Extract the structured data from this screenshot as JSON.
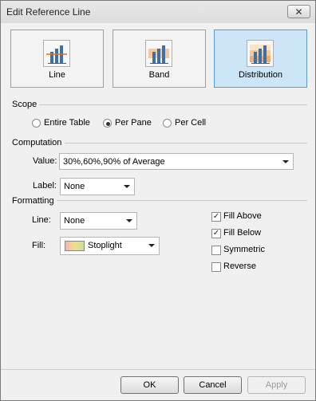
{
  "window": {
    "title": "Edit Reference Line",
    "close_glyph": "✕"
  },
  "type_buttons": [
    {
      "label": "Line",
      "icon": "reference-line-icon",
      "selected": false
    },
    {
      "label": "Band",
      "icon": "reference-band-icon",
      "selected": false
    },
    {
      "label": "Distribution",
      "icon": "reference-distribution-icon",
      "selected": true
    }
  ],
  "scope": {
    "label": "Scope",
    "options": [
      {
        "label": "Entire Table",
        "selected": false
      },
      {
        "label": "Per Pane",
        "selected": true
      },
      {
        "label": "Per Cell",
        "selected": false
      }
    ]
  },
  "computation": {
    "label": "Computation",
    "value_label": "Value:",
    "value": "30%,60%,90% of Average",
    "label_label": "Label:",
    "label_value": "None"
  },
  "formatting": {
    "label": "Formatting",
    "line_label": "Line:",
    "line_value": "None",
    "fill_label": "Fill:",
    "fill_value": "Stoplight",
    "checkboxes": [
      {
        "label": "Fill Above",
        "checked": true
      },
      {
        "label": "Fill Below",
        "checked": true
      },
      {
        "label": "Symmetric",
        "checked": false
      },
      {
        "label": "Reverse",
        "checked": false
      }
    ]
  },
  "buttons": {
    "ok": "OK",
    "cancel": "Cancel",
    "apply": "Apply"
  },
  "colors": {
    "selected_bg": "#cde6f7",
    "selected_border": "#5c9bd1"
  }
}
